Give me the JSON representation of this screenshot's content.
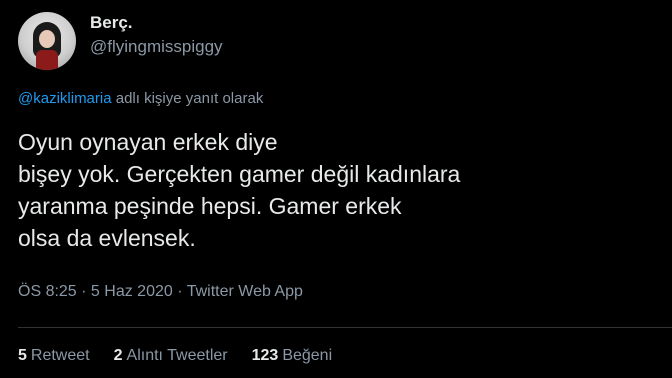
{
  "author": {
    "display_name": "Berç.",
    "handle": "@flyingmisspiggy"
  },
  "reply": {
    "mention": "@kaziklimaria",
    "suffix": " adlı kişiye yanıt olarak"
  },
  "tweet": {
    "lines": [
      "Oyun oynayan erkek diye",
      "bişey yok. Gerçekten gamer değil kadınlara",
      "yaranma peşinde hepsi. Gamer erkek",
      "olsa da evlensek."
    ]
  },
  "meta": {
    "text": "ÖS 8:25 · 5 Haz 2020 · Twitter Web App"
  },
  "stats": {
    "retweets": {
      "count": "5",
      "label": "Retweet"
    },
    "quotes": {
      "count": "2",
      "label": "Alıntı Tweetler"
    },
    "likes": {
      "count": "123",
      "label": "Beğeni"
    }
  },
  "colors": {
    "background": "#000000",
    "text": "#e7e9ea",
    "secondary": "#8b98a5",
    "link": "#1d9bf0"
  }
}
